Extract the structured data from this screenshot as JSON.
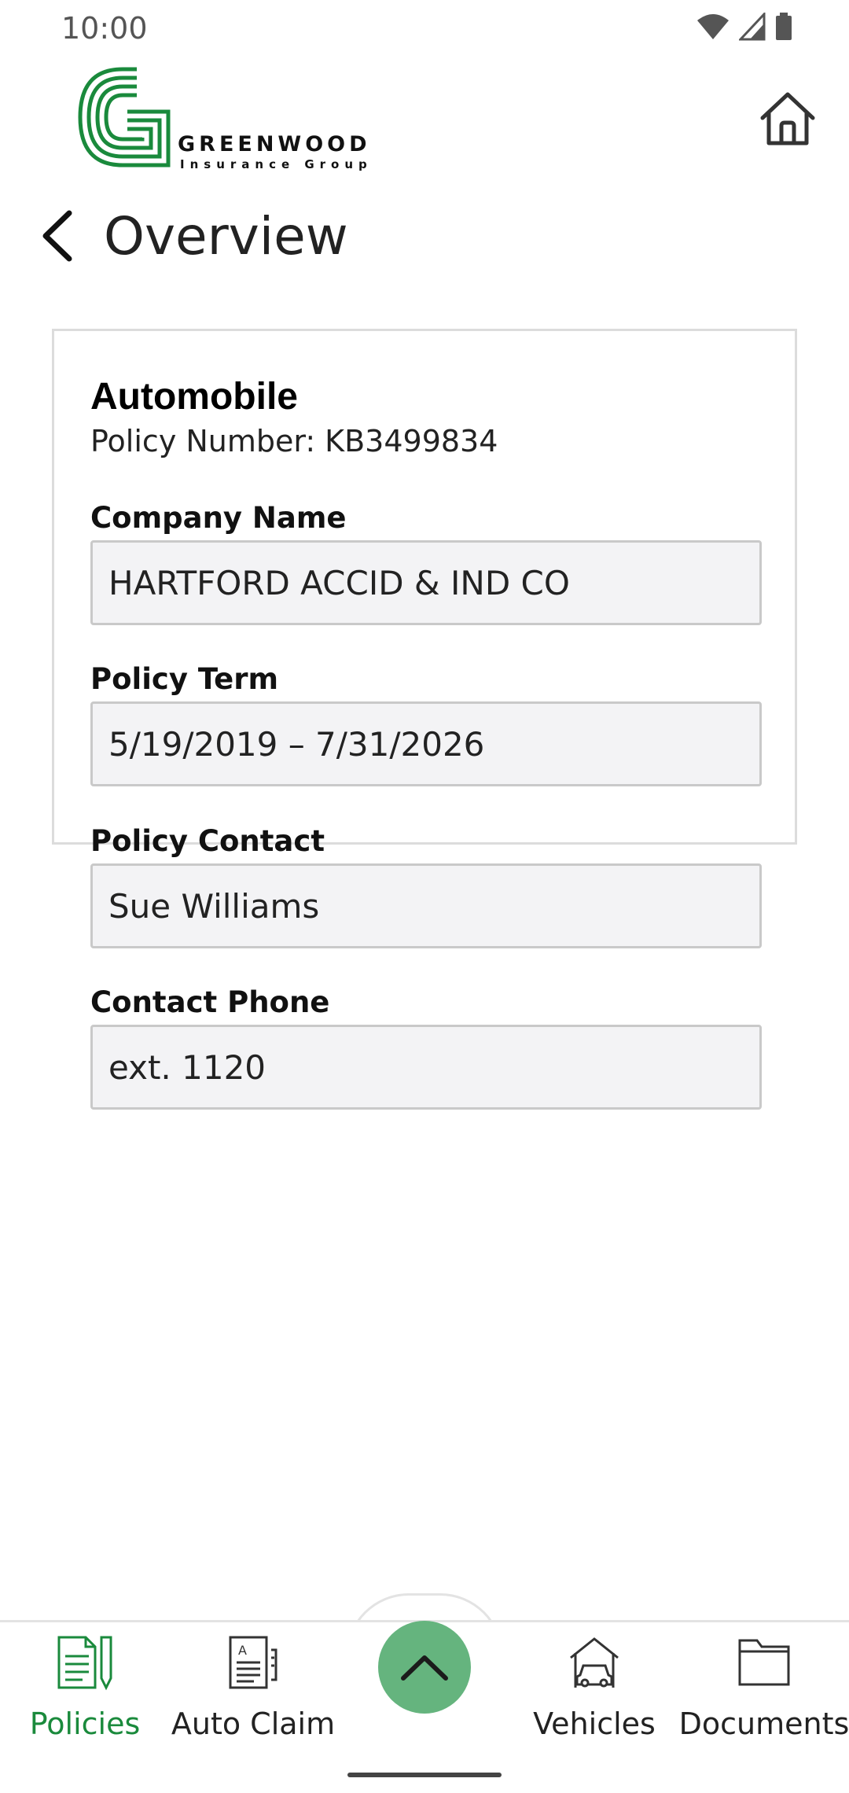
{
  "status_bar": {
    "time": "10:00"
  },
  "brand": {
    "name": "GREENWOOD",
    "tagline": "Insurance Group",
    "color": "#1a8a3c"
  },
  "header": {
    "title": "Overview"
  },
  "policy": {
    "type": "Automobile",
    "number_label": "Policy Number:",
    "number": "KB3499834",
    "fields": [
      {
        "label": "Company Name",
        "value": "HARTFORD ACCID & IND CO"
      },
      {
        "label": "Policy Term",
        "value": "5/19/2019 – 7/31/2026"
      },
      {
        "label": "Policy Contact",
        "value": "Sue Williams"
      },
      {
        "label": "Contact Phone",
        "value": "ext. 1120"
      }
    ]
  },
  "nav": {
    "items": [
      {
        "label": "Policies",
        "icon": "policies-icon",
        "active": true
      },
      {
        "label": "Auto Claim",
        "icon": "auto-claim-icon",
        "active": false
      },
      {
        "label": "Vehicles",
        "icon": "vehicles-icon",
        "active": false
      },
      {
        "label": "Documents",
        "icon": "documents-icon",
        "active": false
      }
    ],
    "center_button_icon": "chevron-up-icon",
    "accent_color": "#65b47e"
  }
}
